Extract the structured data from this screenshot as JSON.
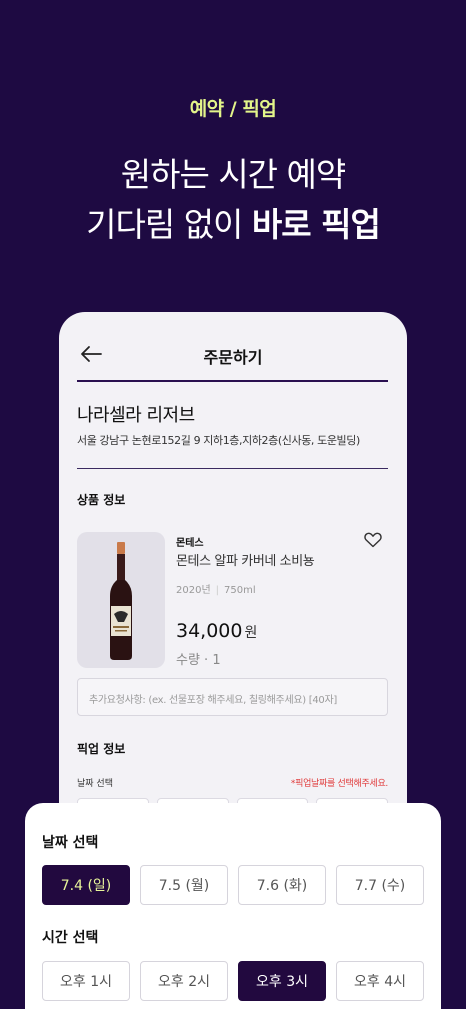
{
  "promo": {
    "tag": "예약 / 픽업",
    "headline_line1": "원하는 시간 예약",
    "headline_line2_regular": "기다림 없이",
    "headline_line2_bold": "바로 픽업"
  },
  "screen": {
    "title": "주문하기",
    "back_icon": "arrow-left-icon",
    "store": {
      "name": "나라셀라 리저브",
      "address": "서울 강남구 논현로152길 9 지하1층,지하2층(신사동, 도운빌딩)"
    },
    "product_section_label": "상품 정보",
    "product": {
      "brand": "몬테스",
      "name": "몬테스 알파 카버네 소비뇽",
      "year": "2020년",
      "volume": "750ml",
      "price": "34,000",
      "price_unit": "원",
      "quantity": "수량 · 1",
      "favorite_icon": "heart-outline-icon"
    },
    "request_placeholder": "추가요청사항: (ex. 선물포장 해주세요, 칠링해주세요) [40자]",
    "pickup_section_label": "픽업 정보",
    "date_select_label": "날짜 선택",
    "date_warning": "*픽업날짜를 선택해주세요."
  },
  "sheet": {
    "date_label": "날짜 선택",
    "dates": [
      "7.4 (일)",
      "7.5 (월)",
      "7.6 (화)",
      "7.7 (수)"
    ],
    "selected_date": "7.4 (일)",
    "time_label": "시간 선택",
    "times": [
      "오후 1시",
      "오후 2시",
      "오후 3시",
      "오후 4시"
    ],
    "selected_time": "오후 3시"
  },
  "colors": {
    "background": "#1e0a42",
    "accent_yellow": "#e3f58a",
    "selected_fill": "#22093f",
    "warning_red": "#e03b3b"
  }
}
